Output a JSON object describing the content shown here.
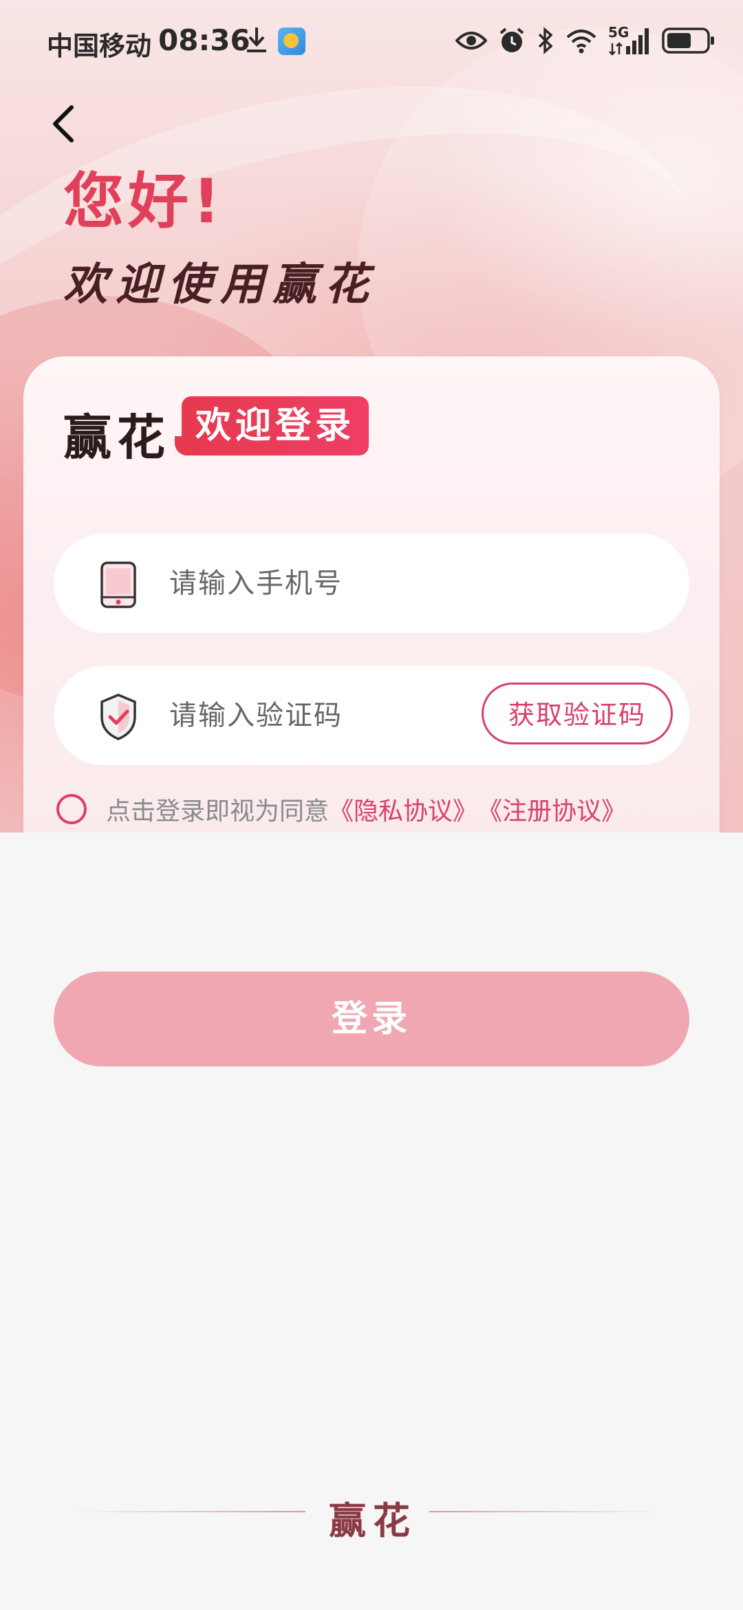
{
  "status_bar": {
    "carrier": "中国移动",
    "time": "08:36",
    "network": "5G"
  },
  "header": {
    "greeting": "您好!",
    "welcome": "欢迎使用赢花"
  },
  "card": {
    "brand": "赢花",
    "tag": "欢迎登录",
    "phone_placeholder": "请输入手机号",
    "code_placeholder": "请输入验证码",
    "get_code_label": "获取验证码",
    "agree_text": "点击登录即视为同意",
    "privacy_link": "《隐私协议》",
    "register_link": "《注册协议》"
  },
  "login_label": "登录",
  "footer_brand": "赢花",
  "colors": {
    "accent": "#d8406a",
    "greeting": "#e0405a",
    "login_button": "#f0a7b1"
  }
}
